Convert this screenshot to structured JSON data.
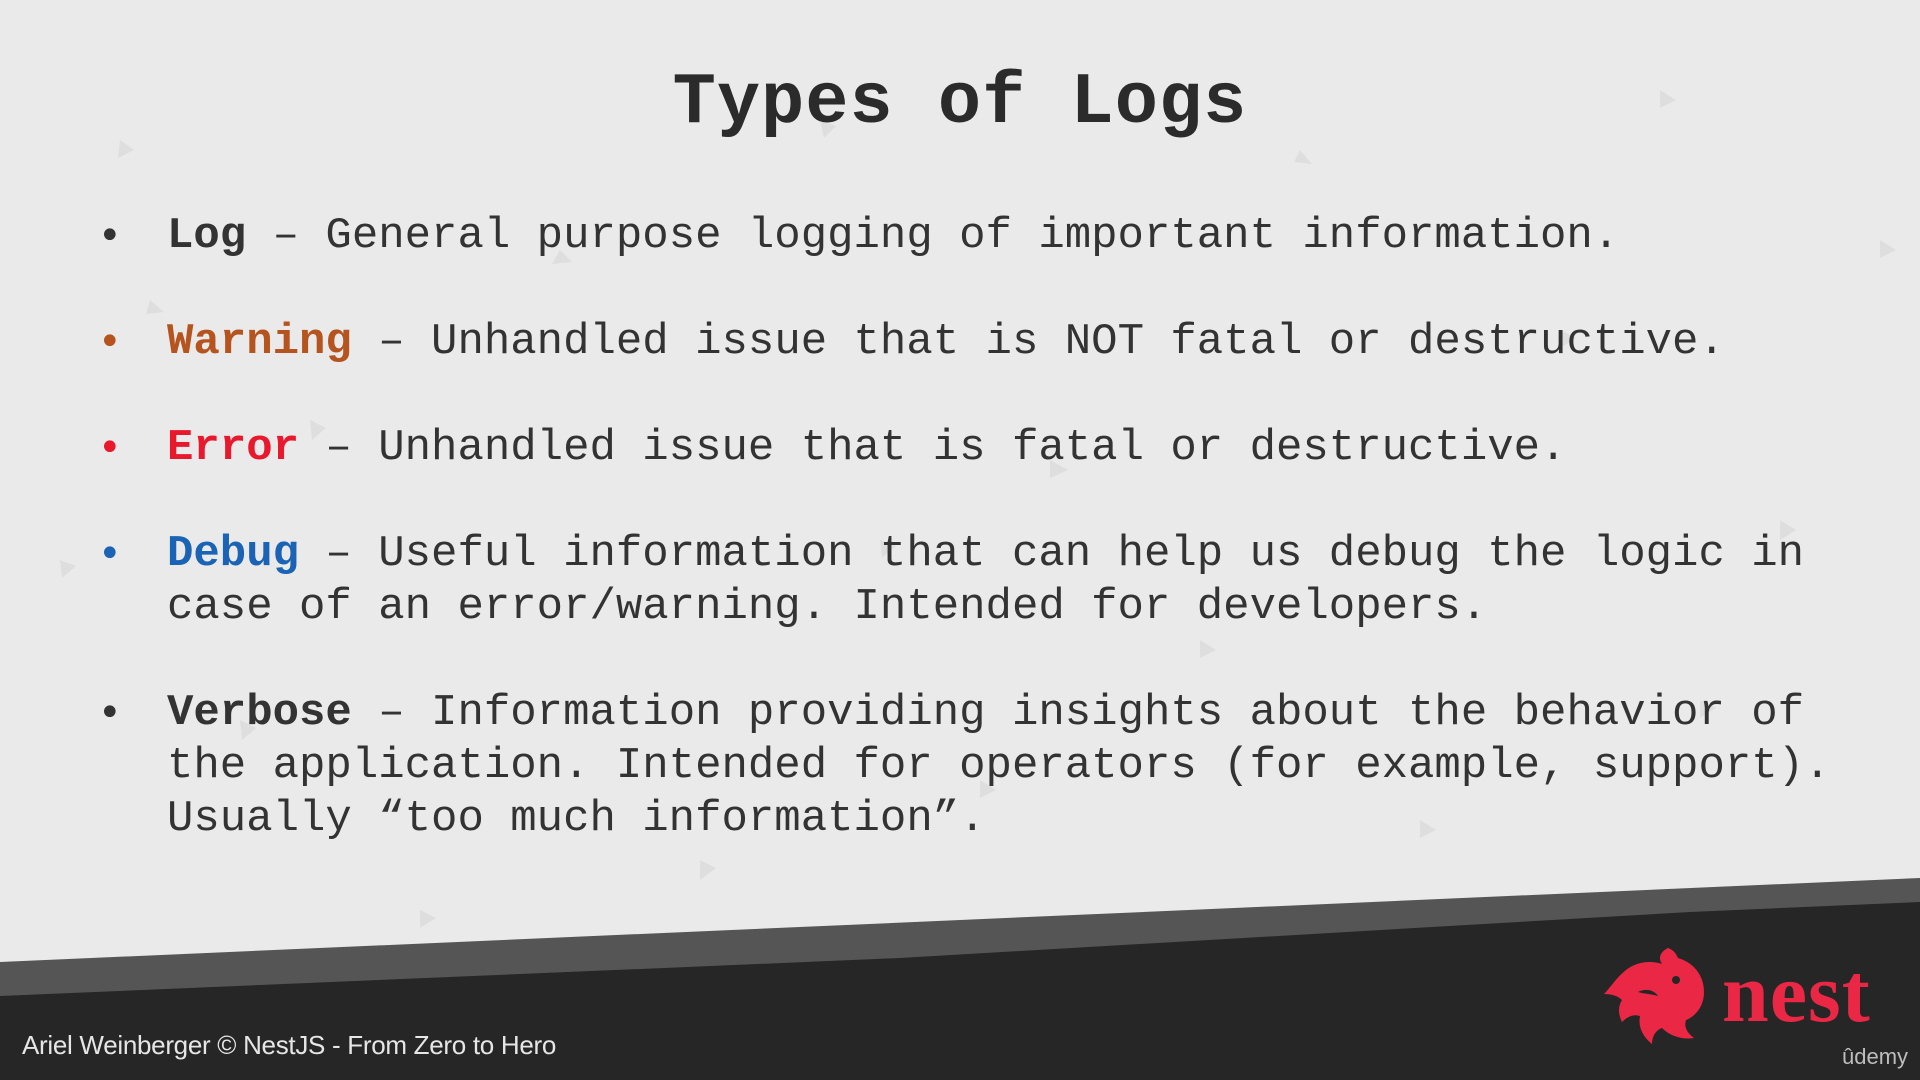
{
  "slide": {
    "title": "Types of Logs",
    "bullets": [
      {
        "term": "Log",
        "text": " – General purpose logging of important information.",
        "color": "#333333"
      },
      {
        "term": "Warning",
        "text": " – Unhandled issue that is NOT fatal or destructive.",
        "color": "#b5541f"
      },
      {
        "term": "Error",
        "text": " – Unhandled issue that is fatal or destructive.",
        "color": "#e8192c"
      },
      {
        "term": "Debug",
        "text": " – Useful information that can help us debug the logic in case of an error/warning. Intended for developers.",
        "color": "#1a63b5"
      },
      {
        "term": "Verbose",
        "text": " – Information providing insights about the behavior of the application. Intended for operators (for example, support). Usually “too much information”.",
        "color": "#333333"
      }
    ]
  },
  "footer": {
    "credit": "Ariel Weinberger © NestJS - From Zero to Hero",
    "brand": "nest",
    "platform": "ûdemy",
    "band_color": "#262626",
    "brand_color": "#ea2845"
  },
  "icons": {
    "logo": "nestjs-logo-icon",
    "bullet": "bullet-dot"
  }
}
